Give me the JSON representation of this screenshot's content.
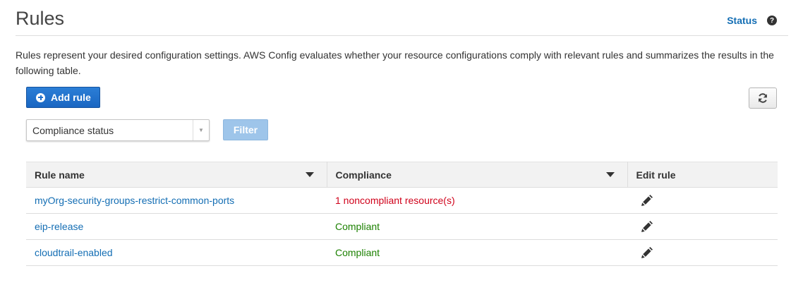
{
  "header": {
    "title": "Rules",
    "status_link": "Status",
    "help_icon": "question-circle-icon",
    "help_glyph": "?"
  },
  "description": "Rules represent your desired configuration settings. AWS Config evaluates whether your resource configurations comply with relevant rules and summarizes the results in the following table.",
  "toolbar": {
    "add_rule_label": "Add rule",
    "add_rule_icon": "plus-circle-icon",
    "refresh_icon": "refresh-icon"
  },
  "filter": {
    "select_value": "Compliance status",
    "button_label": "Filter"
  },
  "table": {
    "columns": [
      "Rule name",
      "Compliance",
      "Edit rule"
    ],
    "rows": [
      {
        "rule_name": "myOrg-security-groups-restrict-common-ports",
        "compliance": "1 noncompliant resource(s)",
        "status": "noncompliant"
      },
      {
        "rule_name": "eip-release",
        "compliance": "Compliant",
        "status": "compliant"
      },
      {
        "rule_name": "cloudtrail-enabled",
        "compliance": "Compliant",
        "status": "compliant"
      }
    ],
    "edit_icon": "pencil-icon"
  },
  "colors": {
    "link": "#146eb4",
    "primary_button": "#1f6fcb",
    "noncompliant": "#d0021b",
    "compliant": "#1d8102"
  }
}
